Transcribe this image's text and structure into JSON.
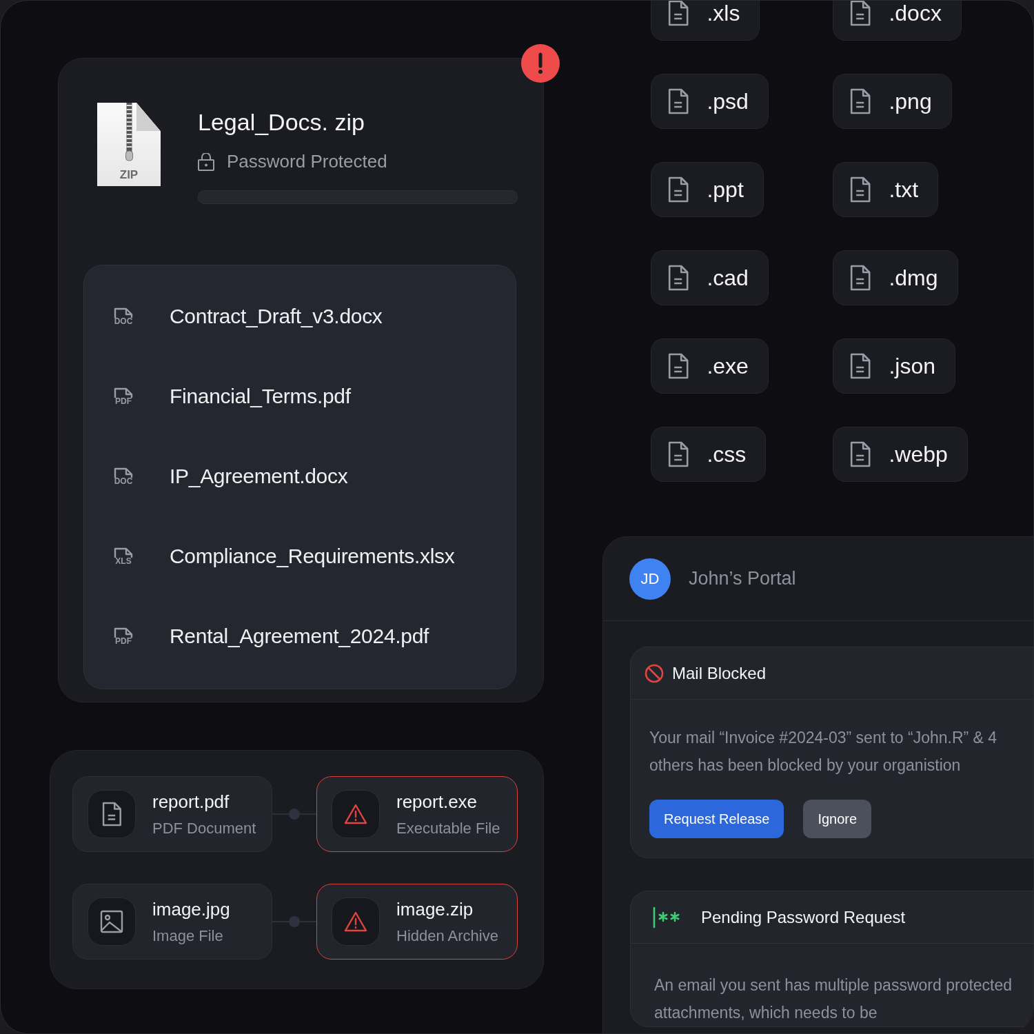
{
  "archive": {
    "name": "Legal_Docs. zip",
    "badge": "ZIP",
    "status": "Password Protected",
    "alert": true,
    "level": 0,
    "files": [
      {
        "type": "DOC",
        "name": "Contract_Draft_v3.docx"
      },
      {
        "type": "PDF",
        "name": "Financial_Terms.pdf"
      },
      {
        "type": "DOC",
        "name": "IP_Agreement.docx"
      },
      {
        "type": "XLS",
        "name": "Compliance_Requirements.xlsx"
      },
      {
        "type": "PDF",
        "name": "Rental_Agreement_2024.pdf"
      }
    ]
  },
  "links": [
    {
      "source": {
        "name": "report.pdf",
        "type": "PDF Document",
        "kind": "document",
        "flagged": false
      },
      "target": {
        "name": "report.exe",
        "type": "Executable File",
        "kind": "warning",
        "flagged": true
      }
    },
    {
      "source": {
        "name": "image.jpg",
        "type": "Image File",
        "kind": "image",
        "flagged": false
      },
      "target": {
        "name": "image.zip",
        "type": "Hidden Archive",
        "kind": "warning",
        "flagged": true
      }
    }
  ],
  "extensions": [
    ".xls",
    ".docx",
    ".psd",
    ".png",
    ".ppt",
    ".txt",
    ".cad",
    ".dmg",
    ".exe",
    ".json",
    ".css",
    ".webp"
  ],
  "portal": {
    "initials": "JD",
    "title": "John’s Portal",
    "alerts": [
      {
        "kind": "blocked",
        "title": "Mail Blocked",
        "message": "Your mail “Invoice #2024-03” sent to “John.R” & 4 others has been blocked by your organistion",
        "buttons": [
          {
            "label": "Request Release",
            "primary": true
          },
          {
            "label": "Ignore",
            "primary": false
          }
        ]
      },
      {
        "kind": "password",
        "title": "Pending Password Request",
        "message": "An email you sent has multiple password protected attachments, which needs to be"
      }
    ]
  }
}
